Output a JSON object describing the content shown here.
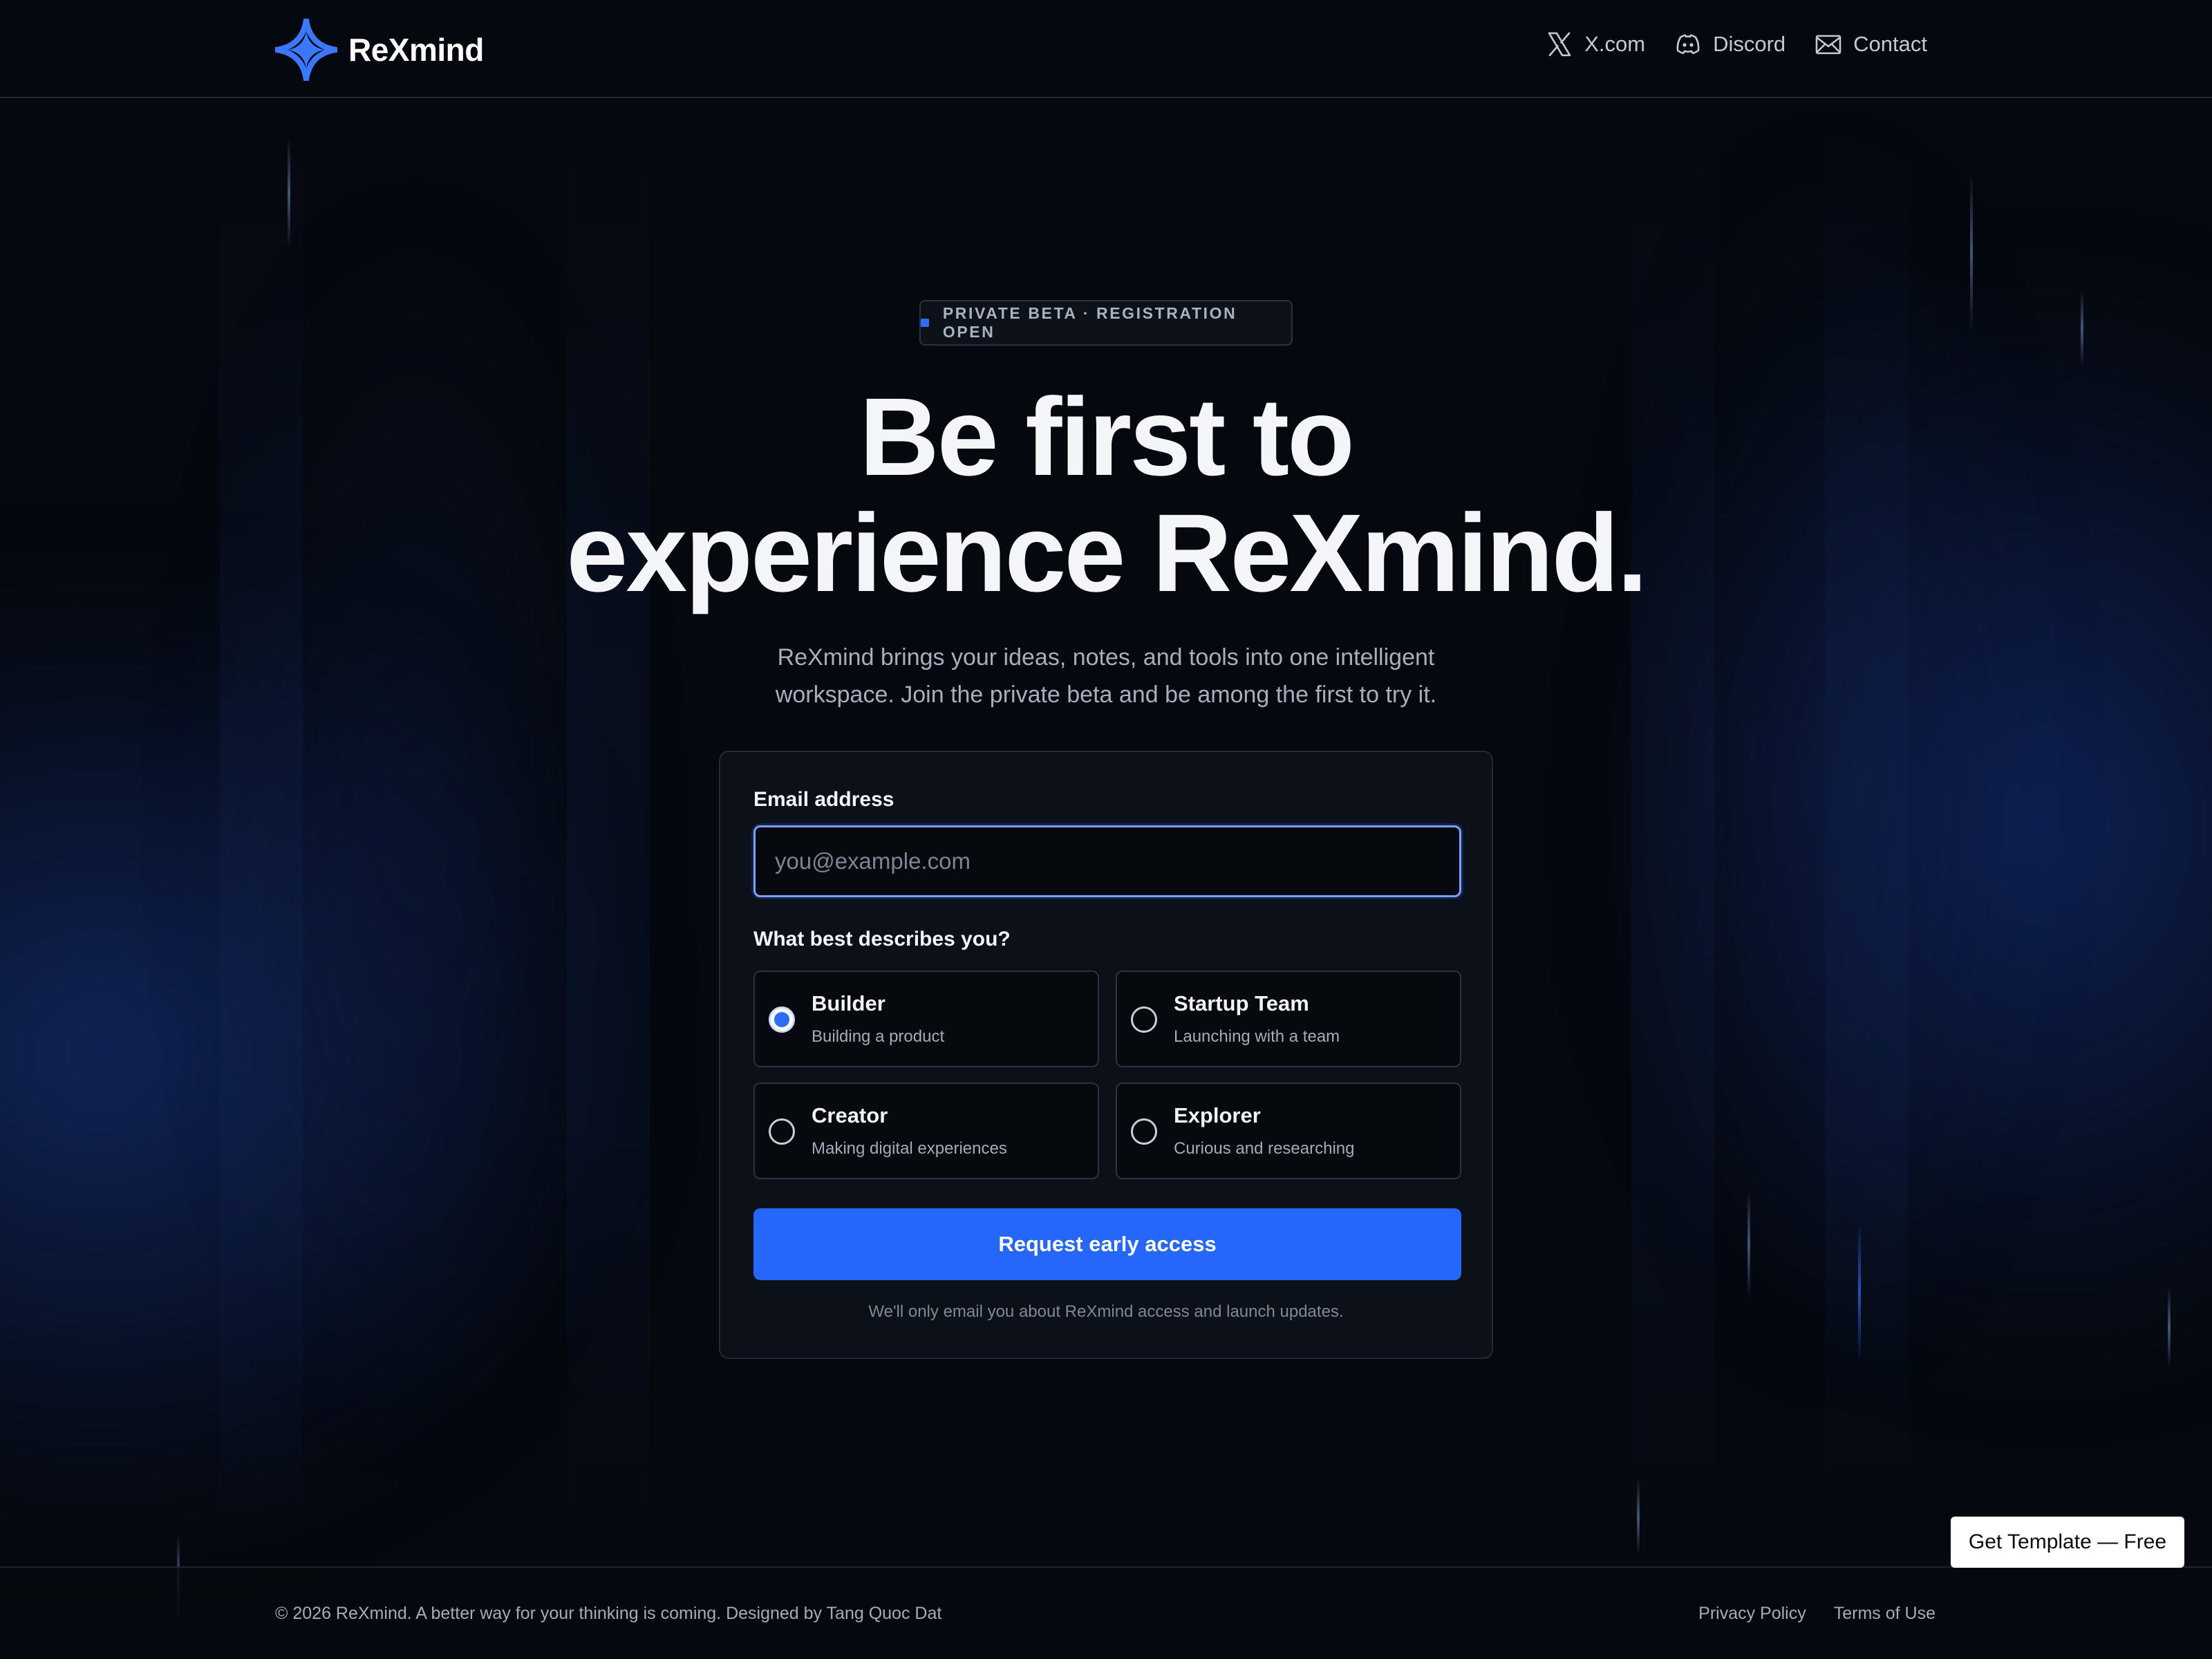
{
  "colors": {
    "accent": "#2567fb",
    "background": "#05080e",
    "card": "#0c1119",
    "input_focus_border": "#7d9dff"
  },
  "header": {
    "brand_name": "ReXmind",
    "logo_icon": "four-point-star-icon",
    "nav": [
      {
        "label": "X.com",
        "icon": "x-logo-icon"
      },
      {
        "label": "Discord",
        "icon": "discord-icon"
      },
      {
        "label": "Contact",
        "icon": "mail-icon"
      }
    ]
  },
  "hero": {
    "badge": "PRIVATE BETA · REGISTRATION OPEN",
    "headline_line1": "Be first to",
    "headline_line2": "experience ReXmind.",
    "subtitle": "ReXmind brings your ideas, notes, and tools into one intelligent workspace. Join the private beta and be among the first to try it."
  },
  "form": {
    "email_label": "Email address",
    "email_placeholder": "you@example.com",
    "email_value": "",
    "role_question": "What best describes you?",
    "options": [
      {
        "title": "Builder",
        "description": "Building a product",
        "selected": true
      },
      {
        "title": "Startup Team",
        "description": "Launching with a team",
        "selected": false
      },
      {
        "title": "Creator",
        "description": "Making digital experiences",
        "selected": false
      },
      {
        "title": "Explorer",
        "description": "Curious and researching",
        "selected": false
      }
    ],
    "submit_label": "Request early access",
    "note": "We'll only email you about ReXmind access and launch updates."
  },
  "footer": {
    "copyright": "© 2026 ReXmind. A better way for your thinking is coming. Designed by Tang Quoc Dat",
    "links": [
      "Privacy Policy",
      "Terms of Use"
    ]
  },
  "floating_button": "Get Template — Free"
}
